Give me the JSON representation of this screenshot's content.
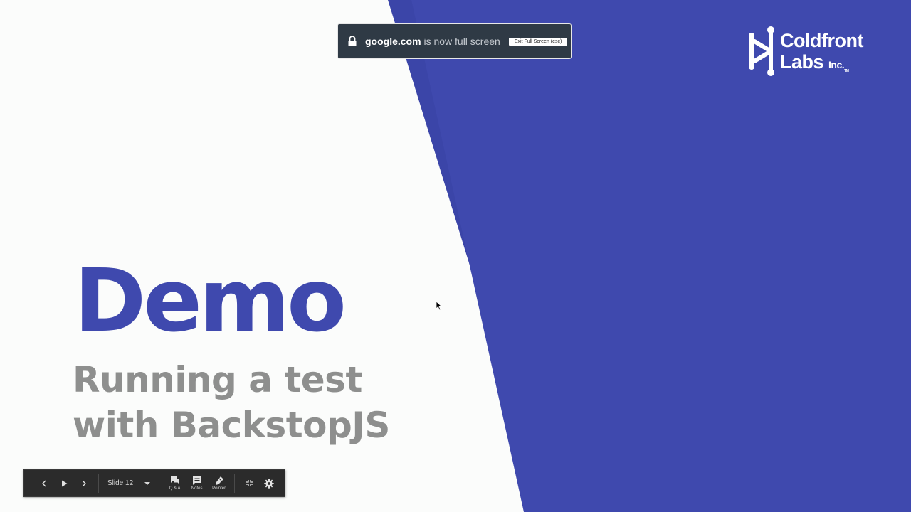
{
  "slide": {
    "title": "Demo",
    "subtitle_line1": "Running a test",
    "subtitle_line2": "with BackstopJS"
  },
  "logo": {
    "line1": "Coldfront",
    "line2": "Labs",
    "suffix": "Inc.",
    "tm": "TM"
  },
  "fullscreen_notice": {
    "domain": "google.com",
    "message": " is now full screen",
    "exit_label": "Exit Full Screen (esc)"
  },
  "toolbar": {
    "slide_label": "Slide 12",
    "qa_label": "Q & A",
    "notes_label": "Notes",
    "pointer_label": "Pointer",
    "icons": {
      "prev": "chevron-left-icon",
      "play": "play-icon",
      "next": "chevron-right-icon",
      "qa": "chat-icon",
      "notes": "notes-icon",
      "pointer": "laser-pointer-icon",
      "exit_fullscreen": "exit-fullscreen-icon",
      "settings": "gear-icon"
    }
  },
  "colors": {
    "accent_blue": "#3f49ae",
    "background": "#fbfcfb",
    "subtitle_gray": "#8e8f8e",
    "toolbar_bg": "#2b2b2b"
  }
}
